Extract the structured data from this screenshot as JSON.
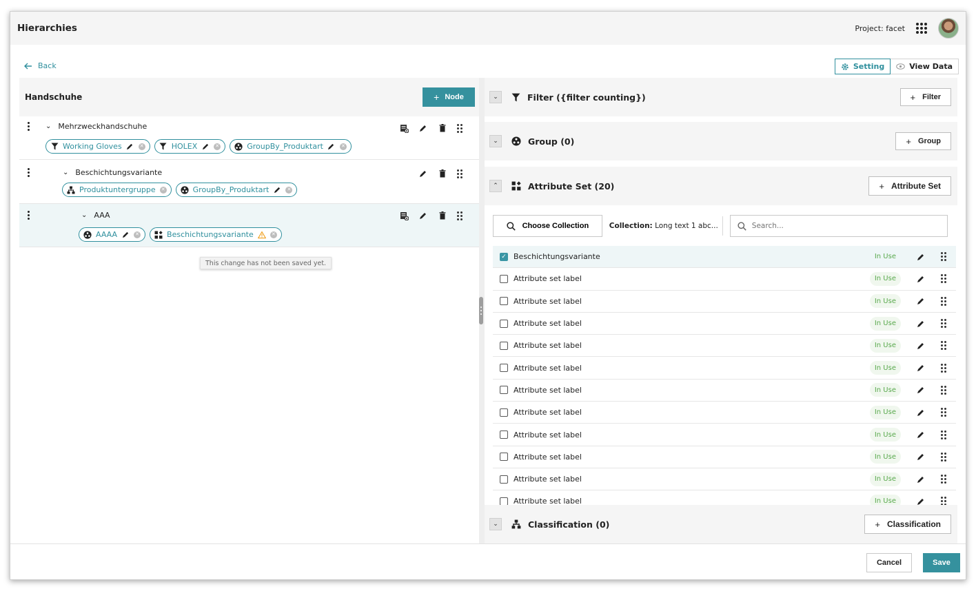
{
  "app": {
    "title": "Hierarchies",
    "project_label": "Project: facet"
  },
  "nav": {
    "back_label": "Back",
    "setting_label": "Setting",
    "view_data_label": "View Data"
  },
  "left": {
    "title": "Handschuhe",
    "node_button_label": "Node",
    "nodes": [
      {
        "label": "Mehrzweckhandschuhe",
        "chips": [
          {
            "icon": "filter-icon",
            "label": "Working Gloves"
          },
          {
            "icon": "filter-icon",
            "label": "HOLEX"
          },
          {
            "icon": "group-icon",
            "label": "GroupBy_Produktart"
          }
        ]
      },
      {
        "label": "Beschichtungsvariante",
        "chips": [
          {
            "icon": "hierarchy-icon",
            "label": "Produktuntergruppe"
          },
          {
            "icon": "group-icon",
            "label": "GroupBy_Produktart"
          }
        ]
      },
      {
        "label": "AAA",
        "chips": [
          {
            "icon": "group-icon",
            "label": "AAAA"
          },
          {
            "icon": "attribute-set-icon",
            "label": "Beschichtungsvariante"
          }
        ]
      }
    ],
    "tooltip": "This change has not been saved yet."
  },
  "right": {
    "filter": {
      "title": "Filter ({filter counting})",
      "button_label": "Filter"
    },
    "group": {
      "title": "Group (0)",
      "button_label": "Group"
    },
    "attribute_set": {
      "title": "Attribute Set (20)",
      "button_label": "Attribute Set",
      "choose_collection_label": "Choose Collection",
      "collection_key": "Collection:",
      "collection_value": "Long text 1 abc...",
      "search_placeholder": "Search...",
      "rows": [
        {
          "label": "Beschichtungsvariante",
          "status": "In Use",
          "checked": true
        },
        {
          "label": "Attribute set label",
          "status": "In Use",
          "checked": false
        },
        {
          "label": "Attribute set label",
          "status": "In Use",
          "checked": false
        },
        {
          "label": "Attribute set label",
          "status": "In Use",
          "checked": false
        },
        {
          "label": "Attribute set label",
          "status": "In Use",
          "checked": false
        },
        {
          "label": "Attribute set label",
          "status": "In Use",
          "checked": false
        },
        {
          "label": "Attribute set label",
          "status": "In Use",
          "checked": false
        },
        {
          "label": "Attribute set label",
          "status": "In Use",
          "checked": false
        },
        {
          "label": "Attribute set label",
          "status": "In Use",
          "checked": false
        },
        {
          "label": "Attribute set label",
          "status": "In Use",
          "checked": false
        },
        {
          "label": "Attribute set label",
          "status": "In Use",
          "checked": false
        },
        {
          "label": "Attribute set label",
          "status": "In Use",
          "checked": false
        }
      ]
    },
    "classification": {
      "title": "Classification (0)",
      "button_label": "Classification"
    }
  },
  "footer": {
    "cancel_label": "Cancel",
    "save_label": "Save"
  },
  "colors": {
    "accent": "#35919e",
    "in_use_text": "#59a94d",
    "warning": "#f0a020"
  }
}
